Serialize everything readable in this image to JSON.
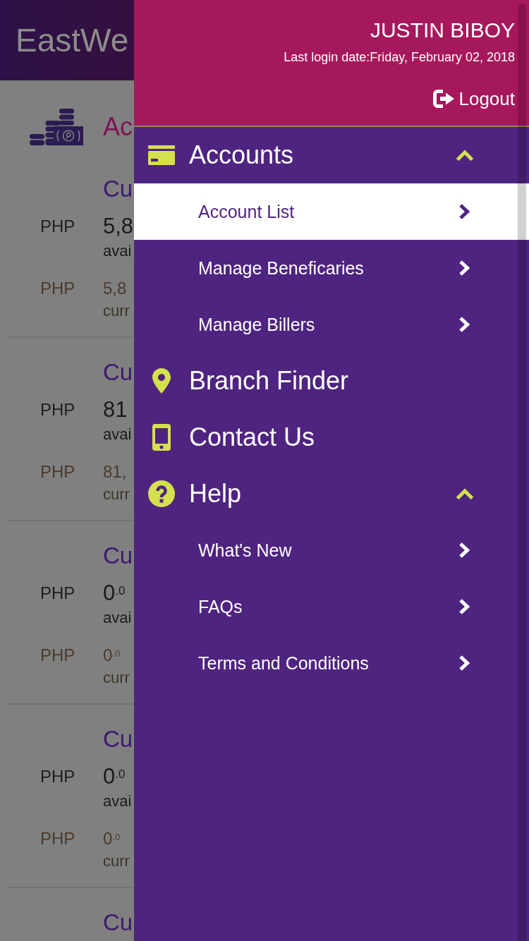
{
  "background_page": {
    "header": {
      "logo_text": "EastWe"
    },
    "section_title": "Ac",
    "accounts": [
      {
        "title": "Cu",
        "available_currency": "PHP",
        "available_amount": "5,8",
        "available_label": "avai",
        "current_currency": "PHP",
        "current_amount": "5,8",
        "current_label": "curr"
      },
      {
        "title": "Cu",
        "available_currency": "PHP",
        "available_amount": "81",
        "available_label": "avai",
        "current_currency": "PHP",
        "current_amount": "81,",
        "current_label": "curr"
      },
      {
        "title": "Cu",
        "available_currency": "PHP",
        "available_amount": "0$^{.0}$",
        "available_label": "avai",
        "current_currency": "PHP",
        "current_amount": "0$^{.0}$",
        "current_label": "curr"
      },
      {
        "title": "Cu",
        "available_currency": "PHP",
        "available_amount": "0$^{.0}$",
        "available_label": "avai",
        "current_currency": "PHP",
        "current_amount": "0$^{.0}$",
        "current_label": "curr"
      },
      {
        "title": "Cu"
      }
    ]
  },
  "drawer": {
    "user_name": "JUSTIN BIBOY",
    "last_login": "Last login date:Friday, February 02, 2018",
    "logout_label": "Logout",
    "menu": [
      {
        "label": "Accounts",
        "expanded": true,
        "children": [
          {
            "label": "Account List",
            "selected": true
          },
          {
            "label": "Manage Beneficaries",
            "selected": false
          },
          {
            "label": "Manage Billers",
            "selected": false
          }
        ]
      },
      {
        "label": "Branch Finder"
      },
      {
        "label": "Contact Us"
      },
      {
        "label": "Help",
        "expanded": true,
        "children": [
          {
            "label": "What's New",
            "selected": false
          },
          {
            "label": "FAQs",
            "selected": false
          },
          {
            "label": "Terms and Conditions",
            "selected": false
          }
        ]
      }
    ]
  }
}
